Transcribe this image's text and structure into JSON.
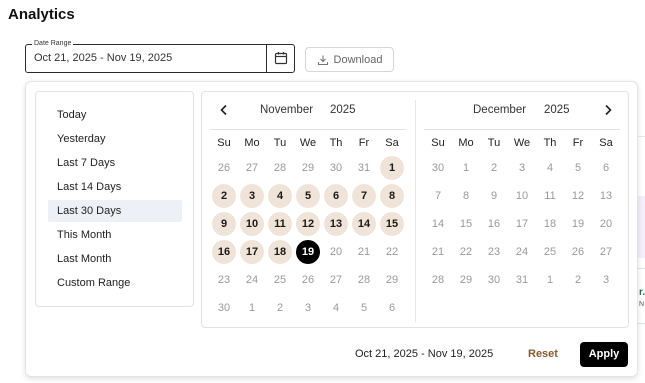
{
  "page": {
    "title": "Analytics"
  },
  "date_range": {
    "label": "Date Range",
    "value": "Oct 21, 2025 - Nov 19, 2025",
    "calendar_icon": "calendar-icon"
  },
  "download": {
    "label": "Download",
    "icon": "download-icon"
  },
  "presets": [
    {
      "label": "Today",
      "active": false
    },
    {
      "label": "Yesterday",
      "active": false
    },
    {
      "label": "Last 7 Days",
      "active": false
    },
    {
      "label": "Last 14 Days",
      "active": false
    },
    {
      "label": "Last 30 Days",
      "active": true
    },
    {
      "label": "This Month",
      "active": false
    },
    {
      "label": "Last Month",
      "active": false
    },
    {
      "label": "Custom Range",
      "active": false
    }
  ],
  "calendars": [
    {
      "month": "November",
      "year": "2025",
      "weekdays": [
        "Su",
        "Mo",
        "Tu",
        "We",
        "Th",
        "Fr",
        "Sa"
      ],
      "days": [
        [
          "26",
          "27",
          "28",
          "29",
          "30",
          "31",
          "1"
        ],
        [
          "2",
          "3",
          "4",
          "5",
          "6",
          "7",
          "8"
        ],
        [
          "9",
          "10",
          "11",
          "12",
          "13",
          "14",
          "15"
        ],
        [
          "16",
          "17",
          "18",
          "19",
          "20",
          "21",
          "22"
        ],
        [
          "23",
          "24",
          "25",
          "26",
          "27",
          "28",
          "29"
        ],
        [
          "30",
          "1",
          "2",
          "3",
          "4",
          "5",
          "6"
        ]
      ],
      "in_range": [
        "0-6",
        "1-0",
        "1-1",
        "1-2",
        "1-3",
        "1-4",
        "1-5",
        "1-6",
        "2-0",
        "2-1",
        "2-2",
        "2-3",
        "2-4",
        "2-5",
        "2-6",
        "3-0",
        "3-1",
        "3-2"
      ],
      "selected": [
        "3-3"
      ]
    },
    {
      "month": "December",
      "year": "2025",
      "weekdays": [
        "Su",
        "Mo",
        "Tu",
        "We",
        "Th",
        "Fr",
        "Sa"
      ],
      "days": [
        [
          "30",
          "1",
          "2",
          "3",
          "4",
          "5",
          "6"
        ],
        [
          "7",
          "8",
          "9",
          "10",
          "11",
          "12",
          "13"
        ],
        [
          "14",
          "15",
          "16",
          "17",
          "18",
          "19",
          "20"
        ],
        [
          "21",
          "22",
          "23",
          "24",
          "25",
          "26",
          "27"
        ],
        [
          "28",
          "29",
          "30",
          "31",
          "1",
          "2",
          "3"
        ]
      ],
      "in_range": [],
      "selected": []
    }
  ],
  "footer": {
    "range_text": "Oct 21, 2025 - Nov 19, 2025",
    "reset_label": "Reset",
    "apply_label": "Apply"
  },
  "background": {
    "card_text": "r.",
    "card_sub": "N"
  },
  "colors": {
    "range_fill": "#f0e4d9",
    "selected_fill": "#000000",
    "reset_text": "#8a5a2b",
    "active_preset": "#edf1f7"
  }
}
